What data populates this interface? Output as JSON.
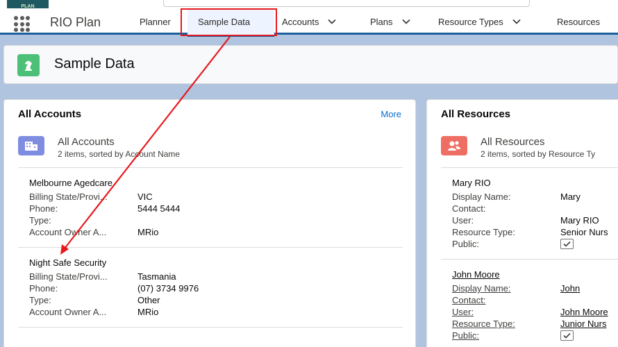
{
  "app": {
    "logo_text": "PLAN",
    "name": "RIO Plan"
  },
  "nav": {
    "items": [
      {
        "label": "Planner",
        "has_menu": false
      },
      {
        "label": "Sample Data",
        "has_menu": false,
        "active": true
      },
      {
        "label": "Accounts",
        "has_menu": true
      },
      {
        "label": "Plans",
        "has_menu": true
      },
      {
        "label": "Resource Types",
        "has_menu": true
      },
      {
        "label": "Resources",
        "has_menu": false
      }
    ]
  },
  "page": {
    "title": "Sample Data",
    "icon": "chess-knight-icon"
  },
  "accounts_card": {
    "title": "All Accounts",
    "more_label": "More",
    "list_title": "All Accounts",
    "list_subtitle": "2 items, sorted by Account Name",
    "records": [
      {
        "name": "Melbourne Agedcare",
        "fields": [
          {
            "label": "Billing State/Provi...",
            "value": "VIC"
          },
          {
            "label": "Phone:",
            "value": "5444 5444"
          },
          {
            "label": "Type:",
            "value": ""
          },
          {
            "label": "Account Owner A...",
            "value": "MRio"
          }
        ]
      },
      {
        "name": "Night Safe Security",
        "fields": [
          {
            "label": "Billing State/Provi...",
            "value": "Tasmania"
          },
          {
            "label": "Phone:",
            "value": "(07) 3734 9976"
          },
          {
            "label": "Type:",
            "value": "Other"
          },
          {
            "label": "Account Owner A...",
            "value": "MRio"
          }
        ]
      }
    ]
  },
  "resources_card": {
    "title": "All Resources",
    "list_title": "All Resources",
    "list_subtitle": "2 items, sorted by Resource Ty",
    "records": [
      {
        "name": "Mary RIO",
        "fields": [
          {
            "label": "Display Name:",
            "value": "Mary"
          },
          {
            "label": "Contact:",
            "value": ""
          },
          {
            "label": "User:",
            "value": "Mary RIO"
          },
          {
            "label": "Resource Type:",
            "value": "Senior Nurs"
          },
          {
            "label": "Public:",
            "checked": true
          }
        ]
      },
      {
        "name": "John Moore",
        "fields": [
          {
            "label": "Display Name:",
            "value": "John"
          },
          {
            "label": "Contact:",
            "value": ""
          },
          {
            "label": "User:",
            "value": "John Moore"
          },
          {
            "label": "Resource Type:",
            "value": "Junior Nurs"
          },
          {
            "label": "Public:",
            "checked": true
          }
        ]
      }
    ]
  },
  "colors": {
    "brand_blue": "#1b5f9e",
    "highlight_red": "#e8171c",
    "page_icon_green": "#4bc076",
    "accounts_icon_purple": "#7f8de1",
    "resources_icon_coral": "#ef6e64"
  }
}
